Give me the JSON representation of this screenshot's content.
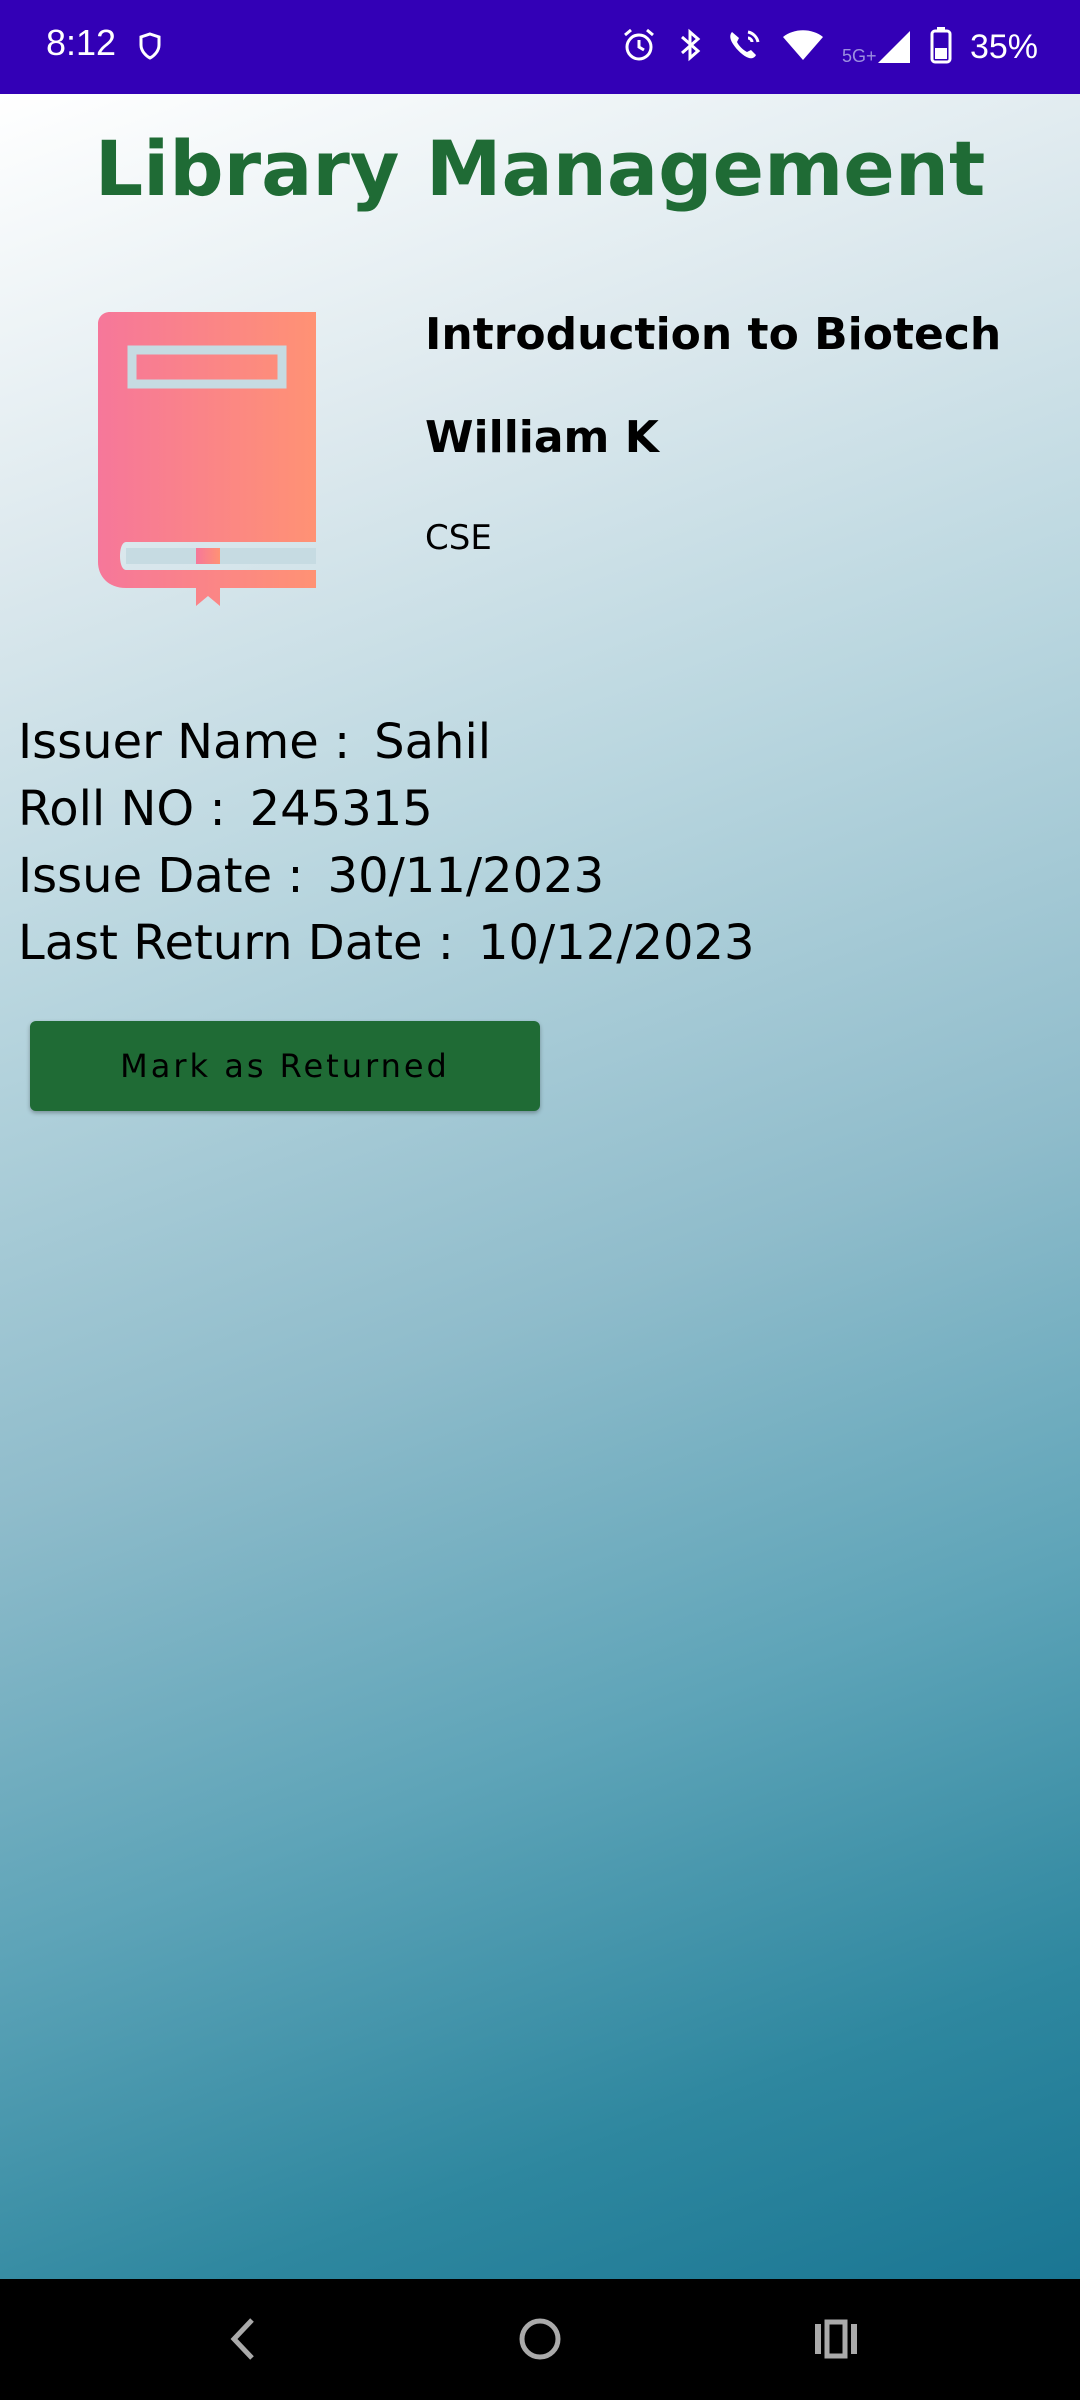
{
  "status_bar": {
    "time": "8:12",
    "battery_percent": "35%",
    "network_label": "5G+",
    "icons": [
      "shield-icon",
      "alarm-icon",
      "bluetooth-icon",
      "wifi-calling-icon",
      "wifi-icon",
      "signal-icon",
      "battery-icon"
    ]
  },
  "header": {
    "title": "Library Management"
  },
  "book": {
    "title": "Introduction to Biotech",
    "author": "William K",
    "department": "CSE",
    "icon": "book-icon"
  },
  "details": {
    "issuer_label": "Issuer Name :",
    "issuer_value": "Sahil",
    "roll_label": "Roll NO :",
    "roll_value": "245315",
    "issue_date_label": "Issue Date :",
    "issue_date_value": "30/11/2023",
    "return_date_label": "Last Return Date :",
    "return_date_value": "10/12/2023"
  },
  "actions": {
    "return_button_label": "Mark as Returned"
  },
  "nav": {
    "icons": [
      "back-icon",
      "home-icon",
      "recents-icon"
    ]
  },
  "colors": {
    "status_bar": "#3300b6",
    "title": "#1f6b35",
    "button": "#1f6b35",
    "book_gradient_start": "#f6779a",
    "book_gradient_end": "#ff9274"
  }
}
